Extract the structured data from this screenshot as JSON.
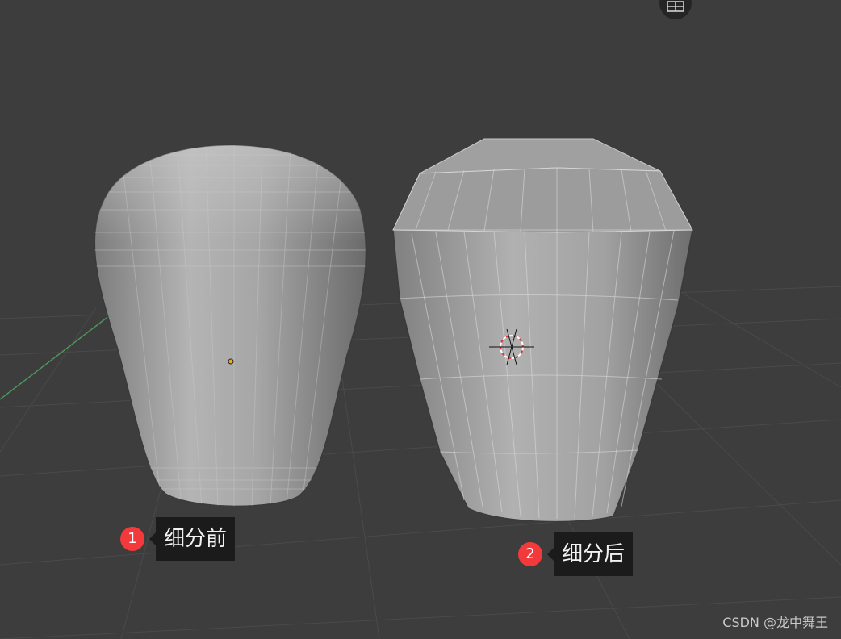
{
  "viewport": {
    "background": "#3d3d3d",
    "grid_color": "#4b4b4b",
    "axis_color": "#4e9a5e"
  },
  "objects": [
    {
      "name": "vase-before-subdivision",
      "shading": "smooth"
    },
    {
      "name": "vase-after-subdivision",
      "shading": "faceted"
    }
  ],
  "annotations": [
    {
      "number": "1",
      "label": "细分前"
    },
    {
      "number": "2",
      "label": "细分后"
    }
  ],
  "watermark": "CSDN @龙中舞王",
  "colors": {
    "badge": "#f23a3c",
    "callout_bg": "#1b1b1b",
    "origin_dot": "#f5a623"
  },
  "icons": [
    "grid-view-icon",
    "origin-point-icon",
    "3d-cursor-icon"
  ]
}
